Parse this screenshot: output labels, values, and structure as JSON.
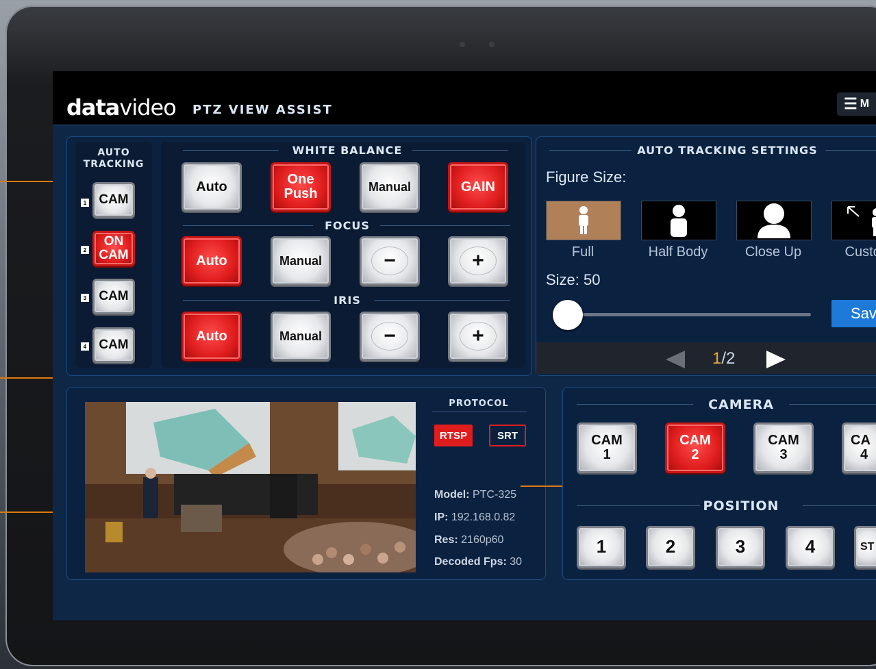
{
  "app": {
    "logo_bold": "data",
    "logo_thin": "video",
    "title": "PTZ VIEW ASSIST",
    "menu_label": "M"
  },
  "auto_tracking": {
    "title_line1": "AUTO",
    "title_line2": "TRACKING",
    "cams": [
      {
        "num": "1",
        "label": "CAM",
        "active": false
      },
      {
        "num": "2",
        "label_line1": "ON",
        "label_line2": "CAM",
        "active": true
      },
      {
        "num": "3",
        "label": "CAM",
        "active": false
      },
      {
        "num": "4",
        "label": "CAM",
        "active": false
      }
    ]
  },
  "white_balance": {
    "title": "WHITE BALANCE",
    "auto": "Auto",
    "one_push_line1": "One",
    "one_push_line2": "Push",
    "manual": "Manual",
    "gain": "GAIN"
  },
  "focus": {
    "title": "FOCUS",
    "auto": "Auto",
    "manual": "Manual",
    "minus": "−",
    "plus": "+"
  },
  "iris": {
    "title": "IRIS",
    "auto": "Auto",
    "manual": "Manual",
    "minus": "−",
    "plus": "+"
  },
  "tracking_settings": {
    "title": "AUTO TRACKING SETTINGS",
    "figure_size_label": "Figure Size:",
    "options": [
      "Full",
      "Half Body",
      "Close Up",
      "Custom"
    ],
    "selected_option": "Full",
    "size_label": "Size: 50",
    "size_value": 50,
    "save_label": "Sav",
    "page_current": "1",
    "page_total": "/2"
  },
  "preview": {
    "protocol_title": "PROTOCOL",
    "rtsp": "RTSP",
    "srt": "SRT",
    "model_key": "Model:",
    "model_val": "PTC-325",
    "ip_key": "IP:",
    "ip_val": "192.168.0.82",
    "res_key": "Res:",
    "res_val": "2160p60",
    "fps_key": "Decoded Fps:",
    "fps_val": "30"
  },
  "camera": {
    "title": "CAMERA",
    "buttons": [
      {
        "l1": "CAM",
        "l2": "1",
        "active": false
      },
      {
        "l1": "CAM",
        "l2": "2",
        "active": true
      },
      {
        "l1": "CAM",
        "l2": "3",
        "active": false
      },
      {
        "l1": "CA",
        "l2": "4",
        "active": false
      }
    ]
  },
  "position": {
    "title": "POSITION",
    "buttons": [
      "1",
      "2",
      "3",
      "4",
      "ST"
    ]
  },
  "colors": {
    "accent_red": "#e01d1d",
    "screen_bg": "#0f2747",
    "callout": "#e07a10",
    "selected_figure": "#b08158",
    "save_blue": "#1e7ad8"
  }
}
